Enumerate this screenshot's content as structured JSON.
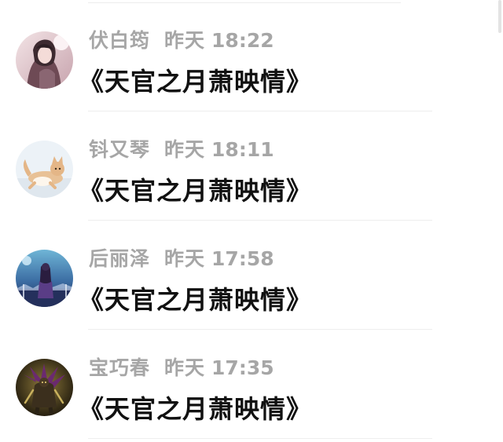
{
  "comments": [
    {
      "name": "伏白筠",
      "day": "昨天",
      "clock": "18:22",
      "text": "《天官之月萧映情》",
      "avatar_icon": "girl-portrait-avatar-icon"
    },
    {
      "name": "钭又琴",
      "day": "昨天",
      "clock": "18:11",
      "text": "《天官之月萧映情》",
      "avatar_icon": "cat-avatar-icon"
    },
    {
      "name": "后丽泽",
      "day": "昨天",
      "clock": "17:58",
      "text": "《天官之月萧映情》",
      "avatar_icon": "night-figure-avatar-icon"
    },
    {
      "name": "宝巧春",
      "day": "昨天",
      "clock": "17:35",
      "text": "《天官之月萧映情》",
      "avatar_icon": "dark-warrior-avatar-icon"
    }
  ],
  "colors": {
    "username": "#a6a6a6",
    "timestamp": "#a6a6a6",
    "comment_text": "#111111",
    "divider": "#eeeeee",
    "background": "#ffffff"
  }
}
